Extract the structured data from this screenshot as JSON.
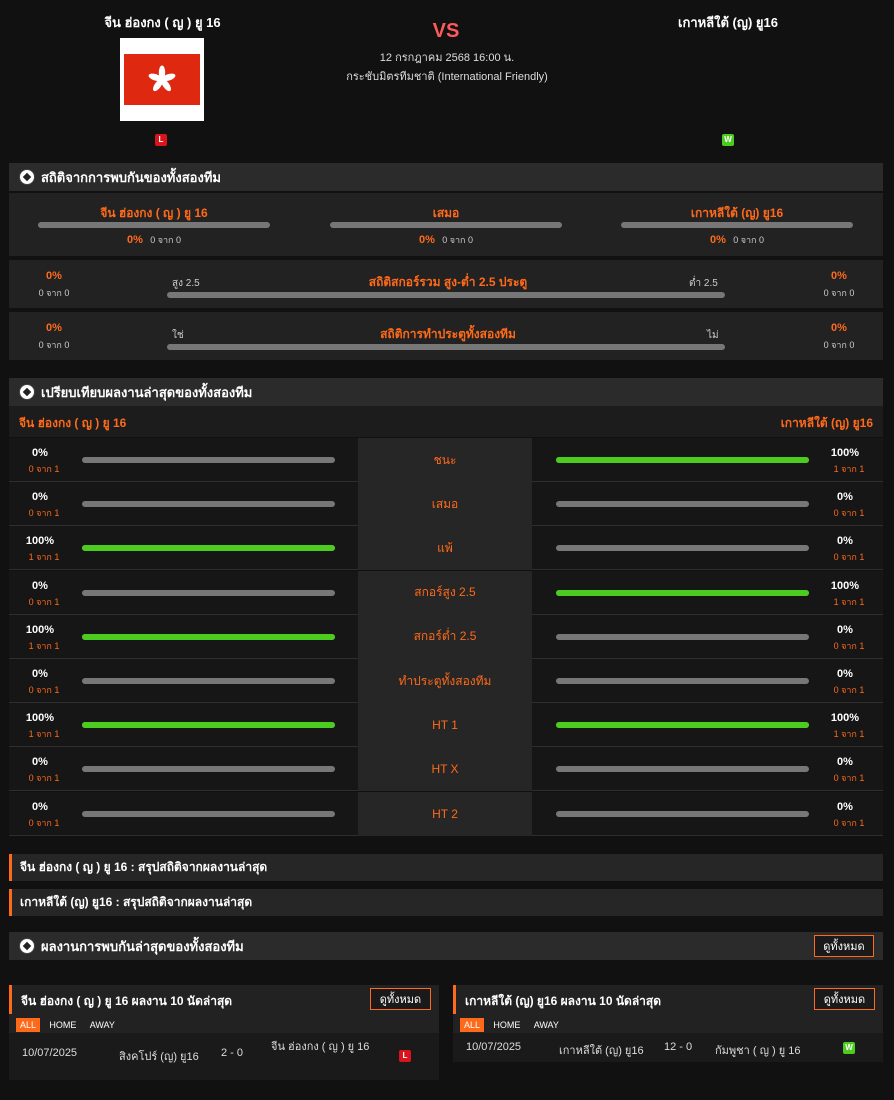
{
  "match": {
    "home": "จีน ฮ่องกง ( ญ ) ยู 16",
    "away": "เกาหลีใต้ (ญ) ยู16",
    "vs": "VS",
    "datetime": "12 กรกฎาคม 2568 16:00 น.",
    "competition": "กระชับมิตรทีมชาติ (International Friendly)",
    "home_form": "L",
    "away_form": "W"
  },
  "h2h": {
    "title": "สถิติจากการพบกันของทั้งสองทีม",
    "cols": [
      {
        "label": "จีน ฮ่องกง ( ญ ) ยู 16",
        "pct": "0%",
        "of": "0 จาก 0"
      },
      {
        "label": "เสมอ",
        "pct": "0%",
        "of": "0 จาก 0"
      },
      {
        "label": "เกาหลีใต้ (ญ) ยู16",
        "pct": "0%",
        "of": "0 จาก 0"
      }
    ],
    "over_under": {
      "title": "สถิติสกอร์รวม สูง-ต่ำ 2.5 ประตู",
      "left_label": "สูง 2.5",
      "right_label": "ต่ำ 2.5",
      "left_pct": "0%",
      "left_of": "0 จาก 0",
      "right_pct": "0%",
      "right_of": "0 จาก 0"
    },
    "btts": {
      "title": "สถิติการทำประตูทั้งสองทีม",
      "left_label": "ใช่",
      "right_label": "ไม่",
      "left_pct": "0%",
      "left_of": "0 จาก 0",
      "right_pct": "0%",
      "right_of": "0 จาก 0"
    }
  },
  "compare": {
    "title": "เปรียบเทียบผลงานล่าสุดของทั้งสองทีม",
    "home": "จีน ฮ่องกง ( ญ ) ยู 16",
    "away": "เกาหลีใต้ (ญ) ยู16",
    "rows": [
      {
        "label": "ชนะ",
        "home_pct": "0%",
        "home_of": "0 จาก 1",
        "home_val": 0,
        "away_pct": "100%",
        "away_of": "1 จาก 1",
        "away_val": 1
      },
      {
        "label": "เสมอ",
        "home_pct": "0%",
        "home_of": "0 จาก 1",
        "home_val": 0,
        "away_pct": "0%",
        "away_of": "0 จาก 1",
        "away_val": 0
      },
      {
        "label": "แพ้",
        "home_pct": "100%",
        "home_of": "1 จาก 1",
        "home_val": 1,
        "away_pct": "0%",
        "away_of": "0 จาก 1",
        "away_val": 0
      },
      {
        "label": "สกอร์สูง 2.5",
        "home_pct": "0%",
        "home_of": "0 จาก 1",
        "home_val": 0,
        "away_pct": "100%",
        "away_of": "1 จาก 1",
        "away_val": 1
      },
      {
        "label": "สกอร์ต่ำ 2.5",
        "home_pct": "100%",
        "home_of": "1 จาก 1",
        "home_val": 1,
        "away_pct": "0%",
        "away_of": "0 จาก 1",
        "away_val": 0
      },
      {
        "label": "ทำประตูทั้งสองทีม",
        "home_pct": "0%",
        "home_of": "0 จาก 1",
        "home_val": 0,
        "away_pct": "0%",
        "away_of": "0 จาก 1",
        "away_val": 0
      },
      {
        "label": "HT 1",
        "home_pct": "100%",
        "home_of": "1 จาก 1",
        "home_val": 1,
        "away_pct": "100%",
        "away_of": "1 จาก 1",
        "away_val": 1
      },
      {
        "label": "HT X",
        "home_pct": "0%",
        "home_of": "0 จาก 1",
        "home_val": 0,
        "away_pct": "0%",
        "away_of": "0 จาก 1",
        "away_val": 0
      },
      {
        "label": "HT 2",
        "home_pct": "0%",
        "home_of": "0 จาก 1",
        "home_val": 0,
        "away_pct": "0%",
        "away_of": "0 จาก 1",
        "away_val": 0
      }
    ]
  },
  "summaries": {
    "home": "จีน ฮ่องกง ( ญ ) ยู 16 : สรุปสถิติจากผลงานล่าสุด",
    "away": "เกาหลีใต้ (ญ) ยู16 : สรุปสถิติจากผลงานล่าสุด"
  },
  "recent_h2h": {
    "title": "ผลงานการพบกันล่าสุดของทั้งสองทีม",
    "view_all": "ดูทั้งหมด"
  },
  "last10": {
    "tabs": [
      "ALL",
      "HOME",
      "AWAY"
    ],
    "home": {
      "title": "จีน ฮ่องกง ( ญ ) ยู 16 ผลงาน 10 นัดล่าสุด",
      "view_all": "ดูทั้งหมด",
      "matches": [
        {
          "date": "10/07/2025",
          "team1": "สิงคโปร์ (ญ) ยู16",
          "score": "2 - 0",
          "team2": "จีน ฮ่องกง ( ญ ) ยู 16",
          "result": "L"
        }
      ]
    },
    "away": {
      "title": "เกาหลีใต้ (ญ) ยู16 ผลงาน 10 นัดล่าสุด",
      "view_all": "ดูทั้งหมด",
      "matches": [
        {
          "date": "10/07/2025",
          "team1": "เกาหลีใต้ (ญ) ยู16",
          "score": "12 - 0",
          "team2": "กัมพูชา ( ญ ) ยู 16",
          "result": "W"
        }
      ]
    }
  },
  "colors": {
    "accent": "#ff6a1a",
    "win": "#4ccc1f",
    "loss": "#d9141c",
    "bar_bg": "#777777"
  }
}
